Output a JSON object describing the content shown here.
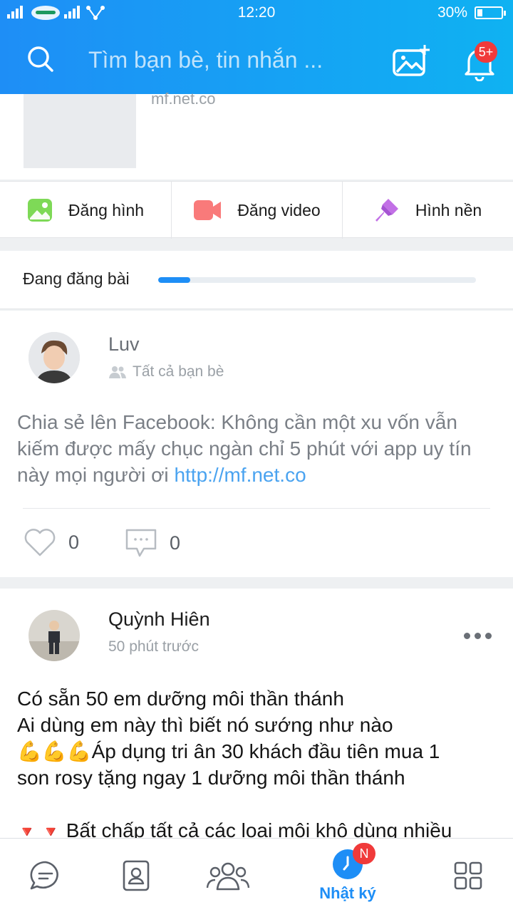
{
  "status_bar": {
    "time": "12:20",
    "battery_pct": "30%",
    "battery_level": 0.3
  },
  "header": {
    "search_placeholder": "Tìm bạn bè, tin nhắn ...",
    "notification_badge": "5+",
    "gradient_colors": [
      "#1e8ef6",
      "#0fb2f2"
    ]
  },
  "profile_strip": {
    "site_text": "mf.net.co"
  },
  "actions": [
    {
      "label": "Đăng hình",
      "icon": "photo-icon"
    },
    {
      "label": "Đăng video",
      "icon": "video-camera-icon"
    },
    {
      "label": "Hình nền",
      "icon": "paint-brush-icon"
    }
  ],
  "uploading": {
    "label": "Đang đăng bài",
    "progress": 0.1
  },
  "posts": [
    {
      "author": "Luv",
      "meta": "Tất cả bạn bè",
      "body_text": "Chia sẻ lên Facebook: Không cần một xu vốn vẫn kiếm được mấy chục ngàn chỉ 5 phút với app uy tín này mọi người ơi ",
      "link_text": "http://mf.net.co",
      "likes": "0",
      "comments": "0"
    },
    {
      "author": "Quỳnh Hiên",
      "meta": "50 phút trước",
      "line1": "Có sẵn 50 em dưỡng môi thần thánh",
      "line2": "Ai dùng em này thì biết nó sướng như nào",
      "line3_emoji": "💪💪💪",
      "line3_text": "Áp dụng tri ân 30 khách đầu tiên mua 1",
      "line4": "son rosy tặng ngay 1 dưỡng môi thần thánh",
      "line5_emoji": "🔻 🔻",
      "line5_text": "Bất chấp tất cả các loại môi khô dùng nhiều"
    }
  ],
  "bottom_nav": {
    "items": [
      "chat-icon",
      "contacts-icon",
      "groups-icon",
      "timeline-icon",
      "more-apps-icon"
    ],
    "active_label": "Nhật ký",
    "active_badge": "N",
    "accent": "#1e8ef6"
  }
}
